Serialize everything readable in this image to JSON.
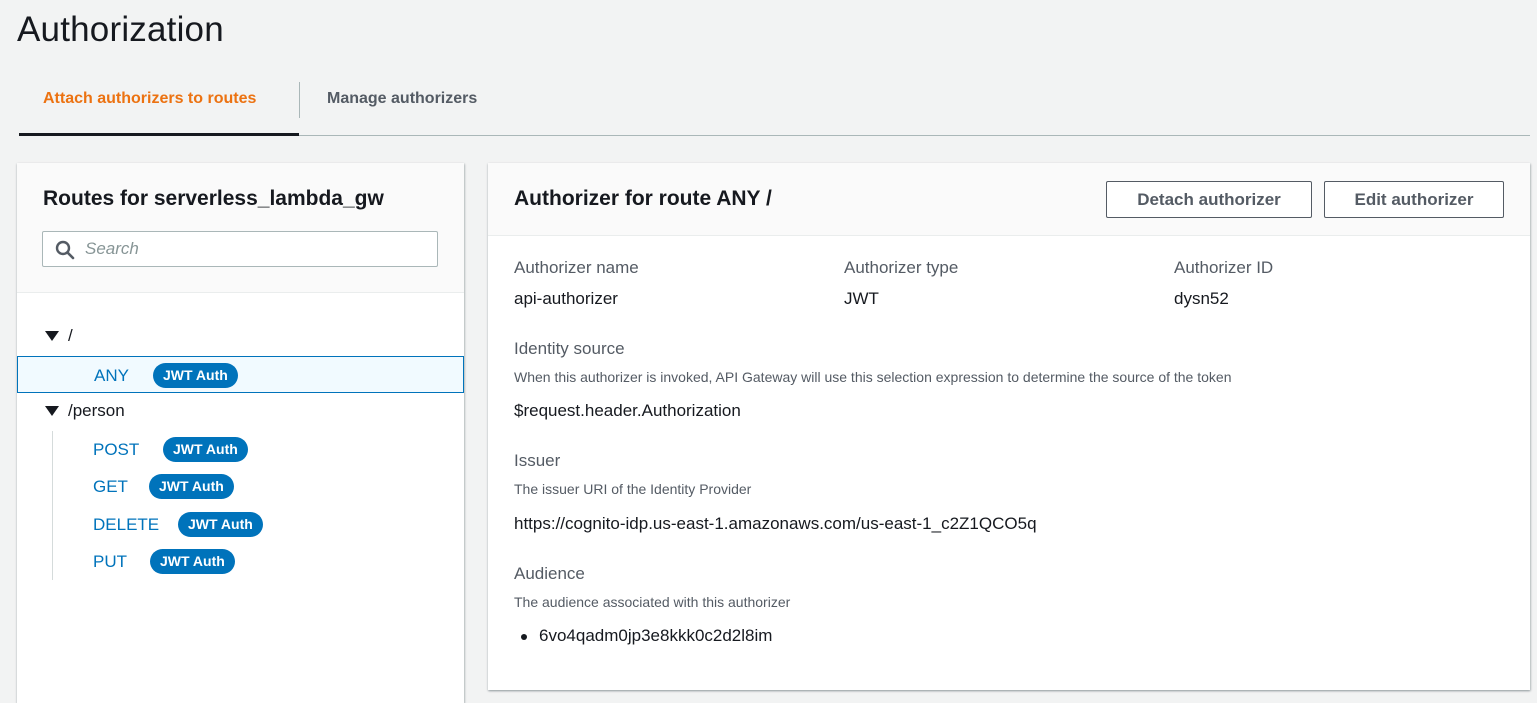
{
  "page": {
    "title": "Authorization"
  },
  "tabs": [
    {
      "label": "Attach authorizers to routes",
      "active": true
    },
    {
      "label": "Manage authorizers",
      "active": false
    }
  ],
  "routes_panel": {
    "title": "Routes for serverless_lambda_gw",
    "search_placeholder": "Search",
    "groups": [
      {
        "path": "/",
        "routes": [
          {
            "method": "ANY",
            "badge": "JWT Auth",
            "selected": true
          }
        ]
      },
      {
        "path": "/person",
        "routes": [
          {
            "method": "POST",
            "badge": "JWT Auth"
          },
          {
            "method": "GET",
            "badge": "JWT Auth"
          },
          {
            "method": "DELETE",
            "badge": "JWT Auth"
          },
          {
            "method": "PUT",
            "badge": "JWT Auth"
          }
        ]
      }
    ]
  },
  "detail": {
    "title": "Authorizer for route ANY /",
    "detach_label": "Detach authorizer",
    "edit_label": "Edit authorizer",
    "authorizer_name_label": "Authorizer name",
    "authorizer_name": "api-authorizer",
    "authorizer_type_label": "Authorizer type",
    "authorizer_type": "JWT",
    "authorizer_id_label": "Authorizer ID",
    "authorizer_id": "dysn52",
    "identity_source_label": "Identity source",
    "identity_source_desc": "When this authorizer is invoked, API Gateway will use this selection expression to determine the source of the token",
    "identity_source": "$request.header.Authorization",
    "issuer_label": "Issuer",
    "issuer_desc": "The issuer URI of the Identity Provider",
    "issuer": "https://cognito-idp.us-east-1.amazonaws.com/us-east-1_c2Z1QCO5q",
    "audience_label": "Audience",
    "audience_desc": "The audience associated with this authorizer",
    "audience": [
      "6vo4qadm0jp3e8kkk0c2d2l8im"
    ]
  },
  "colors": {
    "accent": "#ec7211",
    "link": "#0073bb",
    "badge": "#0073bb"
  },
  "icons": {
    "search": "search-icon",
    "expand": "caret-down-icon"
  }
}
